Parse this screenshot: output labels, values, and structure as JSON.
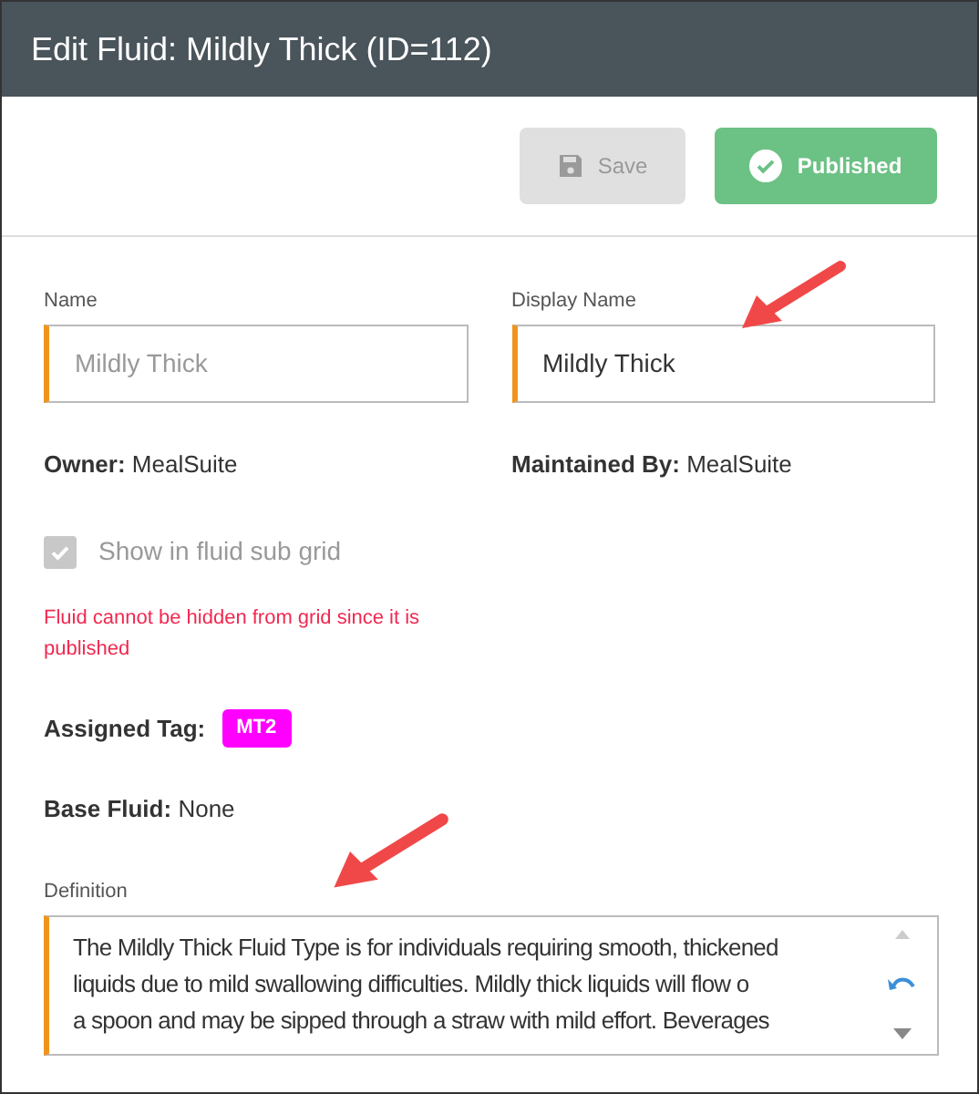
{
  "window": {
    "title": "Edit Fluid: Mildly Thick (ID=112)"
  },
  "buttons": [
    {
      "kind": "save",
      "label": "Save",
      "disabled": true
    },
    {
      "kind": "published",
      "label": "Published",
      "disabled": false
    }
  ],
  "fields": [
    {
      "label": "Name",
      "value": "Mildly Thick",
      "disabled": true
    },
    {
      "label": "Display Name",
      "value": "Mildly Thick",
      "disabled": false
    }
  ],
  "info": [
    {
      "label": "Owner:",
      "value": "MealSuite"
    },
    {
      "label": "Maintained By:",
      "value": "MealSuite"
    }
  ],
  "checkbox": {
    "label": "Show in fluid sub grid",
    "checked": true,
    "disabled": true
  },
  "warning": "Fluid cannot be hidden from grid since it is published",
  "assigned_tag": {
    "label": "Assigned Tag:",
    "tag": "MT2",
    "color": "#ff00ff"
  },
  "base_fluid": {
    "label": "Base Fluid:",
    "value": "None"
  },
  "definition": {
    "label": "Definition",
    "lines": [
      "The Mildly Thick Fluid Type is for individuals requiring smooth, thickened",
      "liquids due to mild swallowing difficulties. Mildly thick liquids will flow o",
      "a spoon and may be sipped through a straw with mild effort. Beverages"
    ]
  }
}
